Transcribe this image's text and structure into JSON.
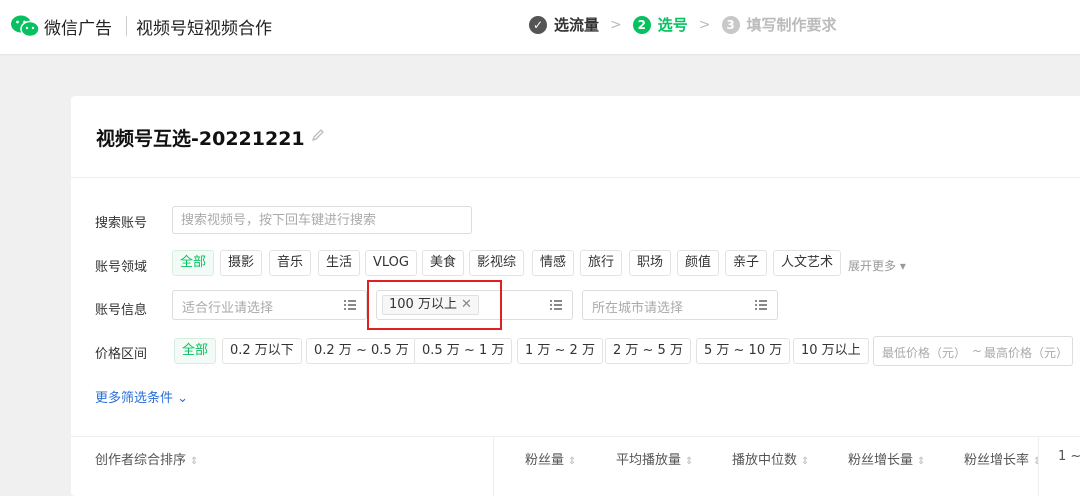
{
  "header": {
    "brand": "微信广告",
    "product": "视频号短视频合作",
    "steps": [
      {
        "index": "✓",
        "label": "选流量",
        "state": "done"
      },
      {
        "index": "2",
        "label": "选号",
        "state": "active"
      },
      {
        "index": "3",
        "label": "填写制作要求",
        "state": "todo"
      }
    ]
  },
  "page": {
    "title": "视频号互选-20221221"
  },
  "filters": {
    "search": {
      "label": "搜索账号",
      "placeholder": "搜索视频号，按下回车键进行搜索"
    },
    "domain": {
      "label": "账号领域",
      "tags": [
        "全部",
        "摄影",
        "音乐",
        "生活",
        "VLOG",
        "美食",
        "影视综",
        "情感",
        "旅行",
        "职场",
        "颜值",
        "亲子",
        "人文艺术"
      ],
      "expand": "展开更多 ▾"
    },
    "info": {
      "label": "账号信息",
      "industry_placeholder": "适合行业请选择",
      "fans_chip": "100 万以上",
      "city_placeholder": "所在城市请选择"
    },
    "price": {
      "label": "价格区间",
      "tags": [
        "全部",
        "0.2 万以下",
        "0.2 万 ~ 0.5 万",
        "0.5 万 ~ 1 万",
        "1 万 ~ 2 万",
        "2 万 ~ 5 万",
        "5 万 ~ 10 万",
        "10 万以上"
      ],
      "min_placeholder": "最低价格（元）",
      "sep": "~",
      "max_placeholder": "最高价格（元）"
    },
    "more": "更多筛选条件"
  },
  "table": {
    "columns": [
      "创作者综合排序",
      "粉丝量",
      "平均播放量",
      "播放中位数",
      "粉丝增长量",
      "粉丝增长率",
      "1 ~"
    ]
  },
  "colors": {
    "accent": "#07c160",
    "highlight_box": "#e02020",
    "link": "#2b6fd6"
  }
}
